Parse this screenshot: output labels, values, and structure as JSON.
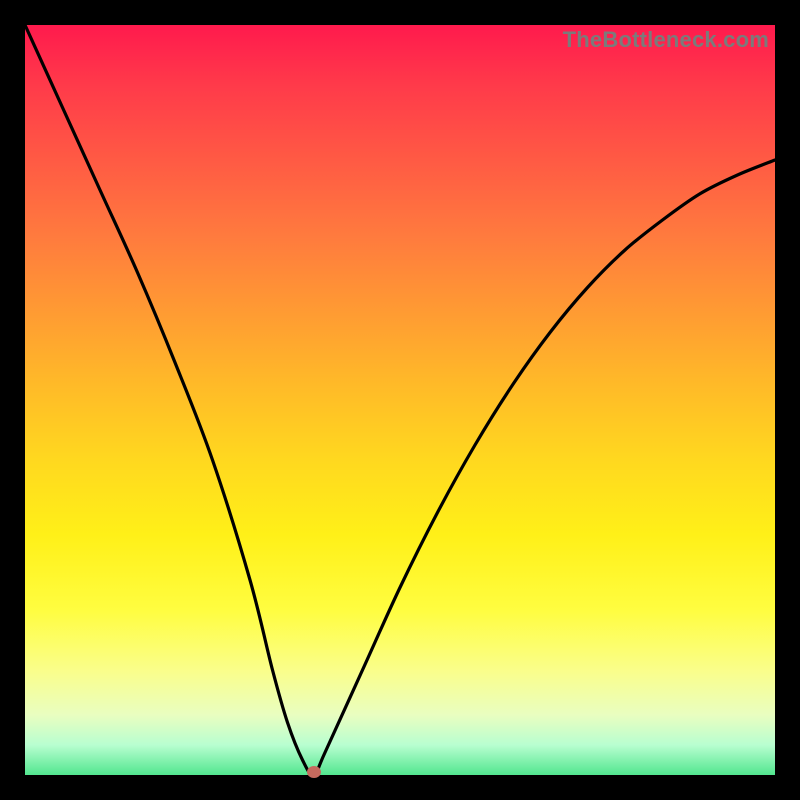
{
  "watermark": "TheBottleneck.com",
  "colors": {
    "curve": "#000000",
    "marker": "#c56a5e",
    "frame": "#000000"
  },
  "chart_data": {
    "type": "line",
    "title": "",
    "xlabel": "",
    "ylabel": "",
    "xlim": [
      0,
      100
    ],
    "ylim": [
      0,
      100
    ],
    "grid": false,
    "legend": false,
    "series": [
      {
        "name": "bottleneck-curve",
        "x": [
          0,
          5,
          10,
          15,
          20,
          25,
          30,
          33,
          35,
          37,
          38.5,
          40,
          45,
          50,
          55,
          60,
          65,
          70,
          75,
          80,
          85,
          90,
          95,
          100
        ],
        "values": [
          100,
          89,
          78,
          67,
          55,
          42,
          26,
          14,
          7,
          2,
          0,
          3,
          14,
          25,
          35,
          44,
          52,
          59,
          65,
          70,
          74,
          77.5,
          80,
          82
        ]
      }
    ],
    "annotations": [
      {
        "name": "minimum-point",
        "x": 38.5,
        "y": 0
      }
    ]
  }
}
